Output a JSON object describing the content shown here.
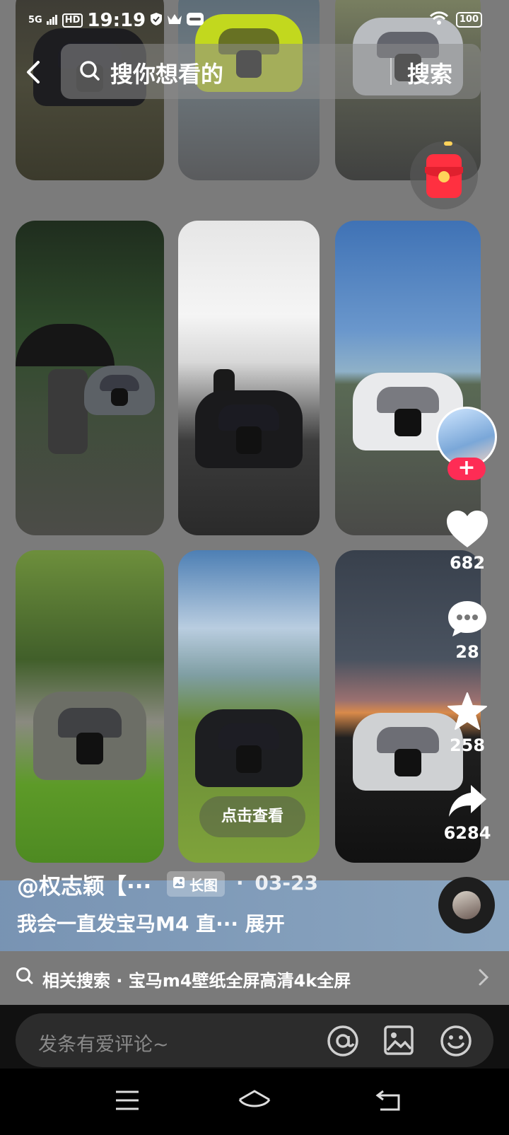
{
  "status_bar": {
    "signal": "5G",
    "hd": "HD",
    "time": "19:19",
    "battery": "100"
  },
  "search": {
    "placeholder": "搜你想看的",
    "button_label": "搜索"
  },
  "overlay": {
    "view_label": "点击查看"
  },
  "actions": {
    "likes": "682",
    "comments": "28",
    "favorites": "258",
    "shares": "6284"
  },
  "post": {
    "author": "@权志颖【···",
    "tag_label": "长图",
    "separator": "·",
    "date": "03-23",
    "description": "我会一直发宝马M4 直··· 展开"
  },
  "related": {
    "label": "相关搜索 · 宝马m4壁纸全屏高清4k全屏"
  },
  "comment_bar": {
    "placeholder": "发条有爱评论~"
  },
  "colors": {
    "accent": "#fe2c55",
    "redpack": "#ff3040",
    "background": "#7b7b7b"
  }
}
